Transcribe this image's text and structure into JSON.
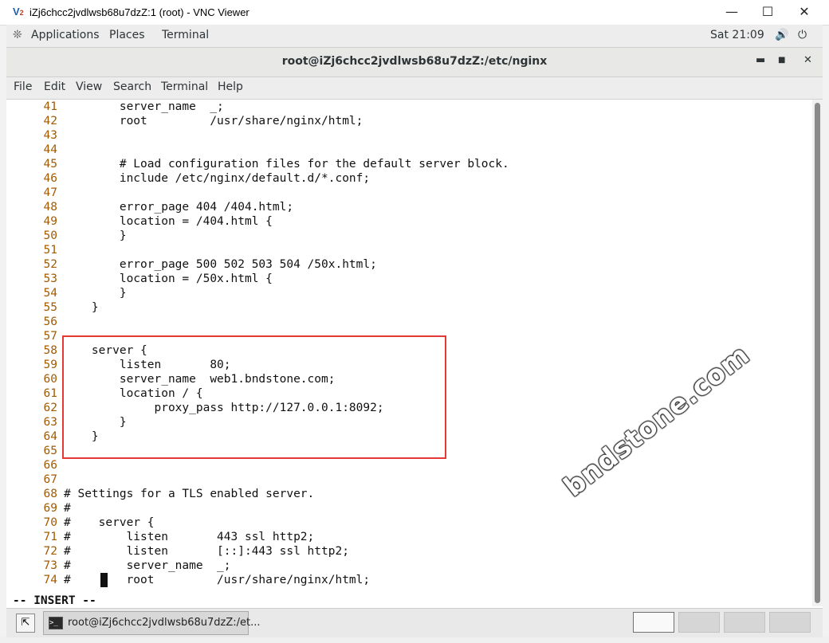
{
  "vnc": {
    "title": "iZj6chcc2jvdlwsb68u7dzZ:1 (root) - VNC Viewer",
    "logo": "V",
    "logo_accent": "2"
  },
  "gnome": {
    "applications": "Applications",
    "places": "Places",
    "terminal": "Terminal",
    "clock": "Sat 21:09"
  },
  "terminal_window": {
    "title": "root@iZj6chcc2jvdlwsb68u7dzZ:/etc/nginx"
  },
  "menu": [
    "File",
    "Edit",
    "View",
    "Search",
    "Terminal",
    "Help"
  ],
  "editor": {
    "lines": [
      {
        "n": "41",
        "text": "        server_name  _;"
      },
      {
        "n": "42",
        "text": "        root         /usr/share/nginx/html;"
      },
      {
        "n": "43",
        "text": ""
      },
      {
        "n": "44",
        "text": ""
      },
      {
        "n": "45",
        "text": "        # Load configuration files for the default server block."
      },
      {
        "n": "46",
        "text": "        include /etc/nginx/default.d/*.conf;"
      },
      {
        "n": "47",
        "text": ""
      },
      {
        "n": "48",
        "text": "        error_page 404 /404.html;"
      },
      {
        "n": "49",
        "text": "        location = /404.html {"
      },
      {
        "n": "50",
        "text": "        }"
      },
      {
        "n": "51",
        "text": ""
      },
      {
        "n": "52",
        "text": "        error_page 500 502 503 504 /50x.html;"
      },
      {
        "n": "53",
        "text": "        location = /50x.html {"
      },
      {
        "n": "54",
        "text": "        }"
      },
      {
        "n": "55",
        "text": "    }"
      },
      {
        "n": "56",
        "text": ""
      },
      {
        "n": "57",
        "text": ""
      },
      {
        "n": "58",
        "text": "    server {"
      },
      {
        "n": "59",
        "text": "        listen       80;"
      },
      {
        "n": "60",
        "text": "        server_name  web1.bndstone.com;"
      },
      {
        "n": "61",
        "text": "        location / {"
      },
      {
        "n": "62",
        "text": "             proxy_pass http://127.0.0.1:8092;"
      },
      {
        "n": "63",
        "text": "        }"
      },
      {
        "n": "64",
        "text": "    }"
      },
      {
        "n": "65",
        "text": ""
      },
      {
        "n": "66",
        "text": ""
      },
      {
        "n": "67",
        "text": ""
      },
      {
        "n": "68",
        "text": "# Settings for a TLS enabled server."
      },
      {
        "n": "69",
        "text": "#"
      },
      {
        "n": "70",
        "text": "#    server {"
      },
      {
        "n": "71",
        "text": "#        listen       443 ssl http2;"
      },
      {
        "n": "72",
        "text": "#        listen       [::]:443 ssl http2;"
      },
      {
        "n": "73",
        "text": "#        server_name  _;"
      },
      {
        "n": "74",
        "text": "#        root         /usr/share/nginx/html;"
      }
    ],
    "mode": "-- INSERT --"
  },
  "watermark": "bndstone.com",
  "taskbar": {
    "task_label": "root@iZj6chcc2jvdlwsb68u7dzZ:/et...",
    "workspaces": 4,
    "active_workspace": 1
  },
  "colors": {
    "line_number": "#a35a00",
    "highlight_box": "#e53935"
  }
}
